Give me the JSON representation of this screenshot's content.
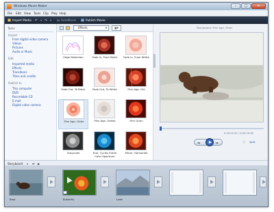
{
  "window": {
    "title": "Windows Movie Maker"
  },
  "menu": [
    "File",
    "Edit",
    "View",
    "Tools",
    "Clip",
    "Play",
    "Help"
  ],
  "toolbar": {
    "import": "Import Media",
    "automovie": "AutoMovie",
    "publish": "Publish Movie"
  },
  "tasks": {
    "header": "Tasks",
    "sections": [
      {
        "title": "Import",
        "links": [
          "From digital video camera",
          "Videos",
          "Pictures",
          "Audio or Music"
        ]
      },
      {
        "title": "Edit",
        "links": [
          "Imported media",
          "Effects",
          "Transitions",
          "Titles and credits"
        ]
      },
      {
        "title": "Publish to",
        "links": [
          "This computer",
          "DVD",
          "Recordable CD",
          "E-mail",
          "Digital video camera"
        ]
      }
    ]
  },
  "collection": {
    "dropdown": "Effects",
    "items": [
      {
        "label": "Edge Detection",
        "icon": "edge-detection-thumb"
      },
      {
        "label": "Fade In, From Black",
        "icon": "fade-in-black-thumb"
      },
      {
        "label": "Fade In, From White",
        "icon": "fade-in-white-thumb"
      },
      {
        "label": "Fade Out, To Black",
        "icon": "fade-out-black-thumb"
      },
      {
        "label": "Fade Out, To White",
        "icon": "fade-out-white-thumb"
      },
      {
        "label": "Film Age, Old",
        "icon": "film-age-old-thumb"
      },
      {
        "label": "Film Age, Older",
        "icon": "film-age-older-thumb"
      },
      {
        "label": "Film Age, Oldest",
        "icon": "film-age-oldest-thumb"
      },
      {
        "label": "Film Grain",
        "icon": "film-grain-thumb"
      },
      {
        "label": "Grayscale",
        "icon": "grayscale-thumb"
      },
      {
        "label": "Hue, Cycles Entire Color Spectrum",
        "icon": "hue-cycle-thumb"
      },
      {
        "label": "Mirror, Horizontal",
        "icon": "mirror-horizontal-thumb"
      }
    ]
  },
  "preview": {
    "caption": "Storyboard: Film Age, Older",
    "time": "0:00:00.00 / 0:00:26.38",
    "split": "Split"
  },
  "storyboard": {
    "label": "Storyboard",
    "clips": [
      {
        "label": "Bear",
        "icon": "bear-clip-thumb"
      },
      {
        "label": "Butterfly",
        "icon": "butterfly-clip-thumb"
      },
      {
        "label": "Lake",
        "icon": "lake-clip-thumb"
      }
    ]
  },
  "colors": {
    "toolbar": "#1f2a3a",
    "link": "#1f4fa3",
    "selected": "#dde8f5",
    "storyboard": "#c2ccd8"
  }
}
